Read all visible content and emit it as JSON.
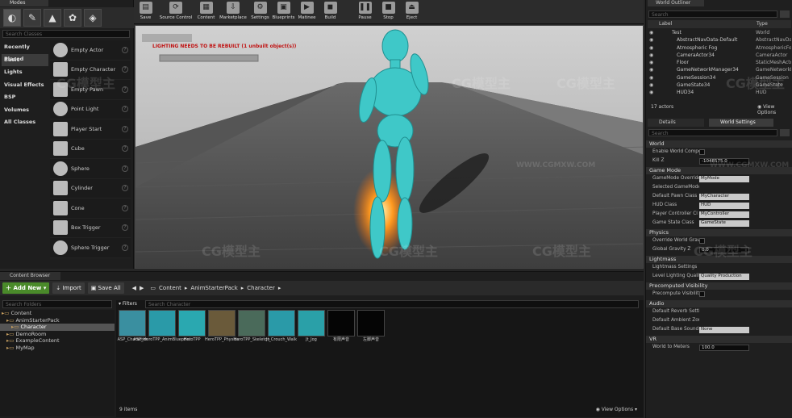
{
  "modes_panel": {
    "tab": "Modes",
    "search_placeholder": "Search Classes",
    "categories": [
      "Recently Placed",
      "Basic",
      "Lights",
      "Visual Effects",
      "BSP",
      "Volumes",
      "All Classes"
    ],
    "items": [
      "Empty Actor",
      "Empty Character",
      "Empty Pawn",
      "Point Light",
      "Player Start",
      "Cube",
      "Sphere",
      "Cylinder",
      "Cone",
      "Box Trigger",
      "Sphere Trigger"
    ]
  },
  "toolbar": {
    "buttons": [
      "Save",
      "Source Control",
      "Content",
      "Marketplace",
      "Settings",
      "Blueprints",
      "Matinee",
      "Build",
      "Pause",
      "Stop",
      "Eject"
    ]
  },
  "viewport": {
    "warning": "LIGHTING NEEDS TO BE REBUILT (1 unbuilt object(s))"
  },
  "content_browser": {
    "tab": "Content Browser",
    "add_new": "Add New",
    "import": "Import",
    "save_all": "Save All",
    "breadcrumb": [
      "Content",
      "AnimStarterPack",
      "Character"
    ],
    "search_folders": "Search Folders",
    "filters": "Filters",
    "search_assets": "Search Character",
    "tree": [
      "Content",
      "AnimStarterPack",
      "Character",
      "DemoRoom",
      "ExampleContent",
      "MyMap"
    ],
    "assets": [
      {
        "name": "ASP_Character",
        "color": "#3a8fa0"
      },
      {
        "name": "ASP_HeroTPP_AnimBlueprint",
        "color": "#2a9aa8"
      },
      {
        "name": "HeroTPP",
        "color": "#2aa8b0"
      },
      {
        "name": "HeroTPP_Physics",
        "color": "#6a5a3a"
      },
      {
        "name": "HeroTPP_Skeleton",
        "color": "#4a6a5a"
      },
      {
        "name": "Jt_Crouch_Walk",
        "color": "#2a9aa8"
      },
      {
        "name": "Jt_Jog",
        "color": "#2aa0a8"
      },
      {
        "name": "有限声音",
        "color": "#050505"
      },
      {
        "name": "左脚声音",
        "color": "#050505"
      }
    ],
    "item_count": "9 items",
    "view_options": "View Options"
  },
  "world_outliner": {
    "tab": "World Outliner",
    "search": "Search",
    "col_label": "Label",
    "col_type": "Type",
    "rows": [
      {
        "label": "Test",
        "type": "World"
      },
      {
        "label": "AbstractNavData-Default",
        "type": "AbstractNavDataM"
      },
      {
        "label": "Atmospheric Fog",
        "type": "AtmosphericFog"
      },
      {
        "label": "CameraActor34",
        "type": "CameraActor"
      },
      {
        "label": "Floor",
        "type": "StaticMeshActor"
      },
      {
        "label": "GameNetworkManager34",
        "type": "GameNetworkMa"
      },
      {
        "label": "GameSession34",
        "type": "GameSession"
      },
      {
        "label": "GameState34",
        "type": "GameState"
      },
      {
        "label": "HUD34",
        "type": "HUD"
      }
    ],
    "count": "17 actors",
    "view_options": "View Options"
  },
  "details": {
    "tab_details": "Details",
    "tab_world": "World Settings",
    "search": "Search",
    "sections": [
      {
        "title": "World",
        "props": [
          {
            "label": "Enable World Compos",
            "value": "",
            "kind": "check"
          },
          {
            "label": "Kill Z",
            "value": "-1048575.0",
            "kind": "text"
          }
        ]
      },
      {
        "title": "Game Mode",
        "props": [
          {
            "label": "GameMode Override",
            "value": "MyMode",
            "kind": "drop"
          },
          {
            "label": "Selected GameMode",
            "value": "",
            "kind": "none"
          },
          {
            "label": "Default Pawn Class",
            "value": "MyCharacter",
            "kind": "drop"
          },
          {
            "label": "HUD Class",
            "value": "HUD",
            "kind": "drop"
          },
          {
            "label": "Player Controller Cl",
            "value": "MyController",
            "kind": "drop"
          },
          {
            "label": "Game State Class",
            "value": "GameState",
            "kind": "drop"
          }
        ]
      },
      {
        "title": "Physics",
        "props": [
          {
            "label": "Override World Gravit",
            "value": "",
            "kind": "check"
          },
          {
            "label": "Global Gravity Z",
            "value": "0.0",
            "kind": "text"
          }
        ]
      },
      {
        "title": "Lightmass",
        "props": [
          {
            "label": "Lightmass Settings",
            "value": "",
            "kind": "none"
          },
          {
            "label": "Level Lighting Quality",
            "value": "Quality Production",
            "kind": "drop"
          }
        ]
      },
      {
        "title": "Precomputed Visibility",
        "props": [
          {
            "label": "Precompute Visibility",
            "value": "",
            "kind": "check"
          }
        ]
      },
      {
        "title": "Audio",
        "props": [
          {
            "label": "Default Reverb Settin",
            "value": "",
            "kind": "none"
          },
          {
            "label": "Default Ambient Zone",
            "value": "",
            "kind": "none"
          },
          {
            "label": "Default Base Sound M",
            "value": "None",
            "kind": "drop"
          }
        ]
      },
      {
        "title": "VR",
        "props": [
          {
            "label": "World to Meters",
            "value": "100.0",
            "kind": "text"
          }
        ]
      }
    ]
  },
  "watermarks": [
    "CG模型主",
    "CG模型主",
    "CG模型主",
    "CG模型主",
    "CG模型主",
    "CG模型主",
    "CG模型主",
    "CG模型主",
    "WWW.CGMXW.COM",
    "WWW.CGMXW.COM"
  ]
}
